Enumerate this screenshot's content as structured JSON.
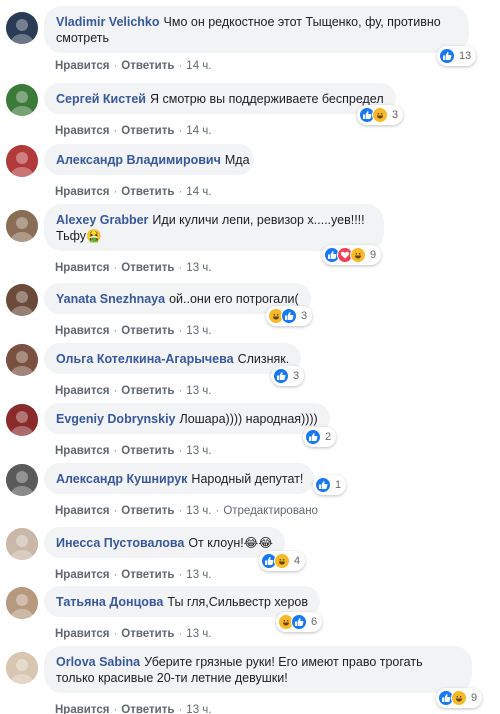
{
  "action_labels": {
    "like": "Нравится",
    "reply": "Ответить",
    "separator": "·"
  },
  "comments": [
    {
      "author": "Vladimir Velichko",
      "text": "Чмо он редкостное этот Тыщенко, фу, противно смотреть",
      "time": "14 ч.",
      "reactions": [
        "like"
      ],
      "reaction_count": "13"
    },
    {
      "author": "Сергей Кистей",
      "text": "Я смотрю вы поддерживаете беспредел",
      "time": "14 ч.",
      "reactions": [
        "like",
        "haha"
      ],
      "reaction_count": "3"
    },
    {
      "author": "Александр Владимирович",
      "text": "Мда",
      "time": "14 ч.",
      "reactions": [],
      "reaction_count": ""
    },
    {
      "author": "Alexey Grabber",
      "text": "Иди куличи лепи, ревизор х.....уев!!!! Тьфу🤮",
      "time": "13 ч.",
      "reactions": [
        "like",
        "love",
        "haha"
      ],
      "reaction_count": "9"
    },
    {
      "author": "Yanata Snezhnaya",
      "text": "ой..они его потрогали(",
      "time": "13 ч.",
      "reactions": [
        "haha",
        "like"
      ],
      "reaction_count": "3"
    },
    {
      "author": "Ольга Котелкина-Агарычева",
      "text": "Слизняк.",
      "time": "13 ч.",
      "reactions": [
        "like"
      ],
      "reaction_count": "3"
    },
    {
      "author": "Evgeniy Dobrynskiy",
      "text": "Лошара)))) народная))))",
      "time": "13 ч.",
      "reactions": [
        "like"
      ],
      "reaction_count": "2"
    },
    {
      "author": "Александр Кушнирук",
      "text": "Народный депутат!",
      "time": "13 ч.",
      "edited": "Отредактировано",
      "reactions": [
        "like"
      ],
      "reaction_count": "1"
    },
    {
      "author": "Инесса Пустовалова",
      "text": "От клоун!😂😂",
      "time": "13 ч.",
      "reactions": [
        "like",
        "haha"
      ],
      "reaction_count": "4"
    },
    {
      "author": "Татьяна Донцова",
      "text": "Ты гля,Сильвестр херов",
      "time": "13 ч.",
      "reactions": [
        "haha",
        "like"
      ],
      "reaction_count": "6"
    },
    {
      "author": "Orlova Sabina",
      "text": "Уберите грязные руки! Его имеют право трогать только красивые 20-ти летние девушки!",
      "time": "13 ч.",
      "reactions": [
        "like",
        "haha"
      ],
      "reaction_count": "9"
    }
  ],
  "colors": {
    "author": "#385898",
    "bubble": "#f2f3f5",
    "like": "#1877f2",
    "haha": "#f7b928",
    "love": "#f33e58",
    "meta": "#606770"
  }
}
